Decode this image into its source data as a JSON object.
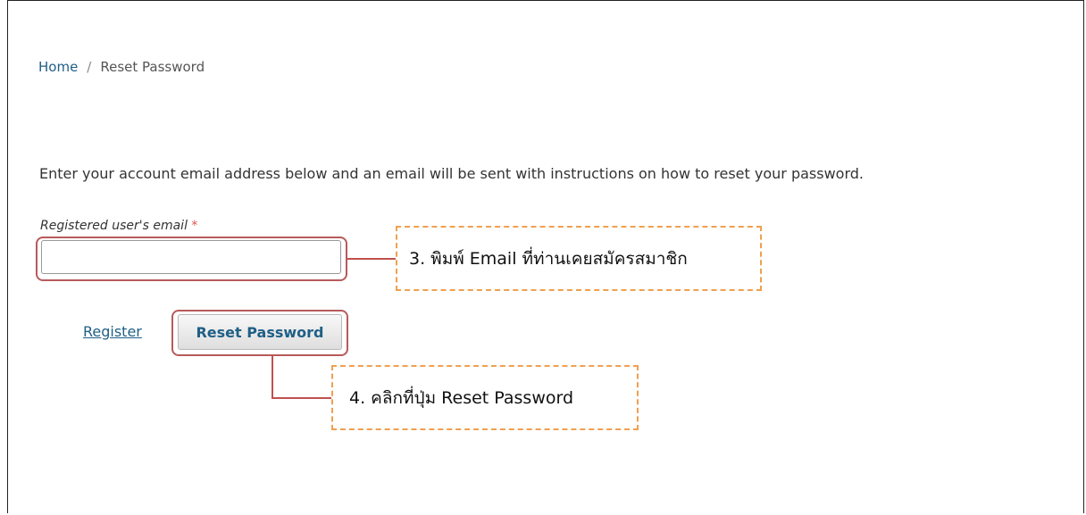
{
  "breadcrumb": {
    "home": "Home",
    "separator": "/",
    "current": "Reset Password"
  },
  "instructions": "Enter your account email address below and an email will be sent with instructions on how to reset your password.",
  "form": {
    "email_label": "Registered user's email",
    "required_mark": "*",
    "email_value": "",
    "register_label": "Register",
    "reset_button_label": "Reset Password"
  },
  "annotations": {
    "step3": "3. พิมพ์ Email ที่ท่านเคยสมัครสมาชิก",
    "step4": "4. คลิกที่ปุ่ม Reset Password"
  },
  "colors": {
    "link": "#1f5f86",
    "highlight_border": "#b85a5a",
    "callout_border": "#f0a050",
    "required": "#d9534f"
  }
}
